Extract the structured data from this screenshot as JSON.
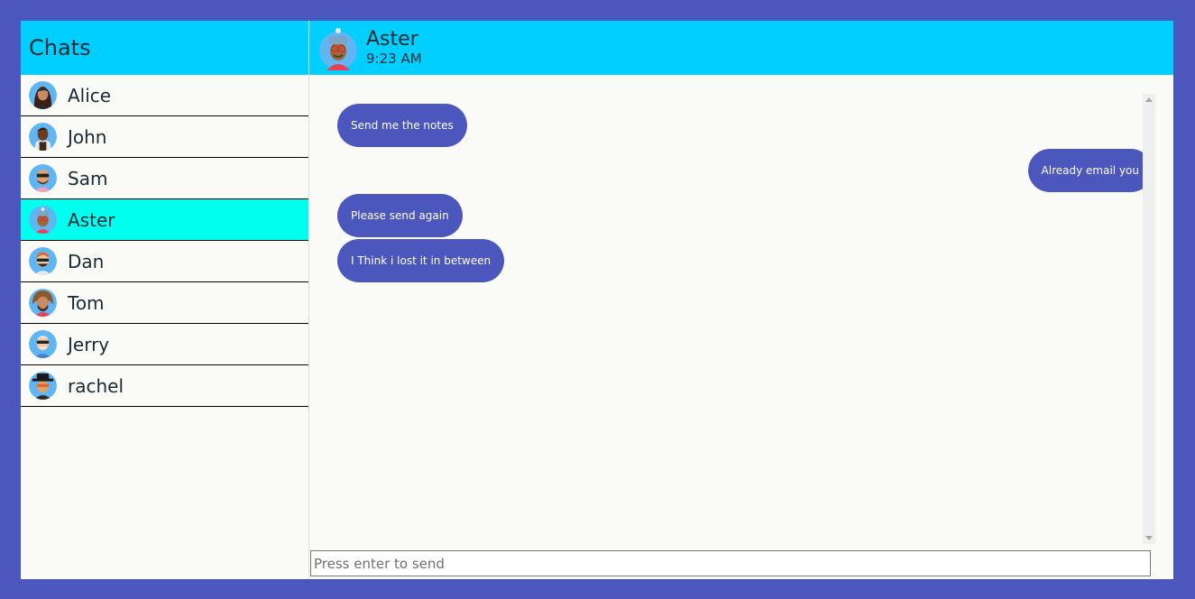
{
  "sidebar": {
    "title": "Chats",
    "items": [
      {
        "label": "Alice",
        "icon": "alice-avatar-icon",
        "active": false
      },
      {
        "label": "John",
        "icon": "john-avatar-icon",
        "active": false
      },
      {
        "label": "Sam",
        "icon": "sam-avatar-icon",
        "active": false
      },
      {
        "label": "Aster",
        "icon": "aster-avatar-icon",
        "active": true
      },
      {
        "label": "Dan",
        "icon": "dan-avatar-icon",
        "active": false
      },
      {
        "label": "Tom",
        "icon": "tom-avatar-icon",
        "active": false
      },
      {
        "label": "Jerry",
        "icon": "jerry-avatar-icon",
        "active": false
      },
      {
        "label": "rachel",
        "icon": "rachel-avatar-icon",
        "active": false
      }
    ]
  },
  "header": {
    "name": "Aster",
    "time": "9:23 AM"
  },
  "messages": [
    {
      "text": "Send me the notes",
      "side": "left"
    },
    {
      "text": "Already email you",
      "side": "right"
    },
    {
      "text": "Please send again",
      "side": "left"
    },
    {
      "text": "I Think i lost it in between",
      "side": "left"
    }
  ],
  "composer": {
    "placeholder": "Press enter to send",
    "value": ""
  },
  "colors": {
    "frame": "#4c57bd",
    "header": "#00cfff",
    "active_item": "#00ffee",
    "bubble": "#4c57bd"
  }
}
